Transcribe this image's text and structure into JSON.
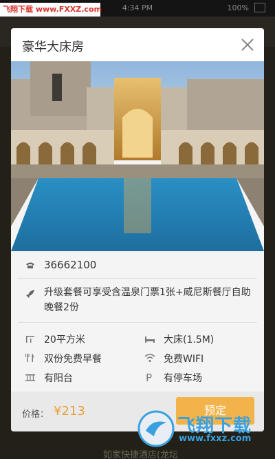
{
  "status_bar": {
    "time": "4:34 PM",
    "battery": "100%"
  },
  "watermark_top": {
    "site": "飞翔下载",
    "url": "www.FXXZ.com"
  },
  "background": {
    "bottom_text": "如家快捷酒店(龙坛"
  },
  "dialog": {
    "title": "豪华大床房",
    "phone": "36662100",
    "promo": "升级套餐可享受含温泉门票1张+威尼斯餐厅自助晚餐2份",
    "amenities": [
      {
        "icon": "area-icon",
        "label": "20平方米"
      },
      {
        "icon": "bed-icon",
        "label": "大床(1.5M)"
      },
      {
        "icon": "dining-icon",
        "label": "双份免费早餐"
      },
      {
        "icon": "wifi-icon",
        "label": "免费WIFI"
      },
      {
        "icon": "balcony-icon",
        "label": "有阳台"
      },
      {
        "icon": "parking-icon",
        "label": "有停车场"
      }
    ],
    "price_label": "价格：",
    "price_value": "¥213",
    "book_label": "预定"
  },
  "watermark_logo": {
    "text": "飞翔下载",
    "url": "www.fxxz.com"
  },
  "colors": {
    "accent": "#f2b44a",
    "price": "#e9a03a"
  }
}
